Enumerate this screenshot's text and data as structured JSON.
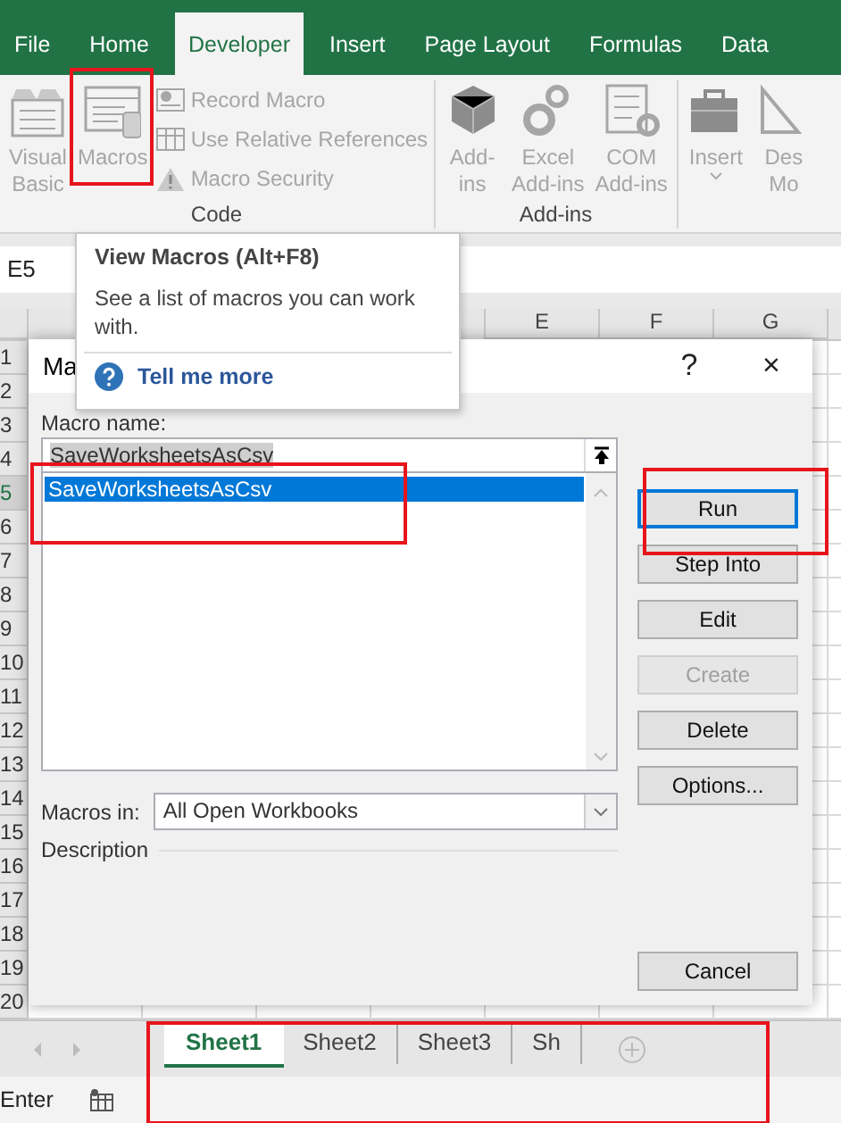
{
  "ribbon": {
    "tabs": [
      {
        "label": "File",
        "selected": false
      },
      {
        "label": "Home",
        "selected": false
      },
      {
        "label": "Developer",
        "selected": true
      },
      {
        "label": "Insert",
        "selected": false
      },
      {
        "label": "Page Layout",
        "selected": false
      },
      {
        "label": "Formulas",
        "selected": false
      },
      {
        "label": "Data",
        "selected": false
      }
    ],
    "groups": [
      {
        "label": "Code",
        "commands": [
          {
            "kind": "large",
            "lines": [
              "Visual",
              "Basic"
            ],
            "disabled": true,
            "highlighted": false
          },
          {
            "kind": "large",
            "lines": [
              "Macros"
            ],
            "disabled": true,
            "highlighted": true
          },
          {
            "kind": "small",
            "lines": [
              "Record Macro"
            ],
            "disabled": true,
            "highlighted": false
          },
          {
            "kind": "small",
            "lines": [
              "Use Relative References"
            ],
            "disabled": true,
            "highlighted": false
          },
          {
            "kind": "small",
            "lines": [
              "Macro Security"
            ],
            "disabled": true,
            "highlighted": false
          }
        ]
      },
      {
        "label": "Add-ins",
        "commands": [
          {
            "kind": "large",
            "lines": [
              "Add-",
              "ins"
            ],
            "disabled": true,
            "highlighted": false
          },
          {
            "kind": "large",
            "lines": [
              "Excel",
              "Add-ins"
            ],
            "disabled": true,
            "highlighted": false
          },
          {
            "kind": "large",
            "lines": [
              "COM",
              "Add-ins"
            ],
            "disabled": true,
            "highlighted": false
          }
        ]
      },
      {
        "commands": [
          {
            "kind": "dropdown",
            "lines": [
              "Insert"
            ],
            "disabled": true,
            "highlighted": false
          },
          {
            "kind": "large",
            "lines": [
              "Des",
              "Mo"
            ],
            "disabled": true,
            "highlighted": false
          }
        ]
      }
    ]
  },
  "name_box": "E5",
  "grid": {
    "columns": [
      {
        "label": "E",
        "selected": false
      },
      {
        "label": "F",
        "selected": false
      },
      {
        "label": "G",
        "selected": false
      }
    ],
    "rows": [
      {
        "label": "1",
        "selected": false
      },
      {
        "label": "2",
        "selected": false
      },
      {
        "label": "3",
        "selected": false
      },
      {
        "label": "4",
        "selected": false
      },
      {
        "label": "5",
        "selected": true
      },
      {
        "label": "6",
        "selected": false
      },
      {
        "label": "7",
        "selected": false
      },
      {
        "label": "8",
        "selected": false
      },
      {
        "label": "9",
        "selected": false
      },
      {
        "label": "10",
        "selected": false
      },
      {
        "label": "11",
        "selected": false
      },
      {
        "label": "12",
        "selected": false
      },
      {
        "label": "13",
        "selected": false
      },
      {
        "label": "14",
        "selected": false
      },
      {
        "label": "15",
        "selected": false
      },
      {
        "label": "16",
        "selected": false
      },
      {
        "label": "17",
        "selected": false
      },
      {
        "label": "18",
        "selected": false
      },
      {
        "label": "19",
        "selected": false
      },
      {
        "label": "20",
        "selected": false
      }
    ]
  },
  "tooltip": {
    "title": "View Macros (Alt+F8)",
    "text": "See a list of macros you can work with.",
    "link": "Tell me more"
  },
  "dialog": {
    "title": "Ma",
    "help_button": "?",
    "close_button": "×",
    "macro_name_label": "Macro name:",
    "macro_name": "SaveWorksheetsAsCsv",
    "macro_name_selected": true,
    "macros": [
      {
        "name": "SaveWorksheetsAsCsv",
        "selected": true
      }
    ],
    "list_highlighted": true,
    "buttons": [
      {
        "label": "Run",
        "focused": true,
        "disabled": false,
        "highlighted": true
      },
      {
        "label": "Step Into",
        "focused": false,
        "disabled": false,
        "highlighted": false
      },
      {
        "label": "Edit",
        "focused": false,
        "disabled": false,
        "highlighted": false
      },
      {
        "label": "Create",
        "focused": false,
        "disabled": true,
        "highlighted": false
      },
      {
        "label": "Delete",
        "focused": false,
        "disabled": false,
        "highlighted": false
      },
      {
        "label": "Options...",
        "focused": false,
        "disabled": false,
        "highlighted": false
      },
      {
        "label": "Cancel",
        "focused": false,
        "disabled": false,
        "highlighted": false
      }
    ],
    "macros_in_label": "Macros in:",
    "macros_in": "All Open Workbooks",
    "description_label": "Description"
  },
  "sheet_tabs": {
    "highlighted": true,
    "tabs": [
      {
        "label": "Sheet1",
        "selected": true
      },
      {
        "label": "Sheet2",
        "selected": false
      },
      {
        "label": "Sheet3",
        "selected": false
      },
      {
        "label": "Sh",
        "selected": false
      }
    ]
  },
  "status_bar": {
    "mode": "Enter"
  }
}
